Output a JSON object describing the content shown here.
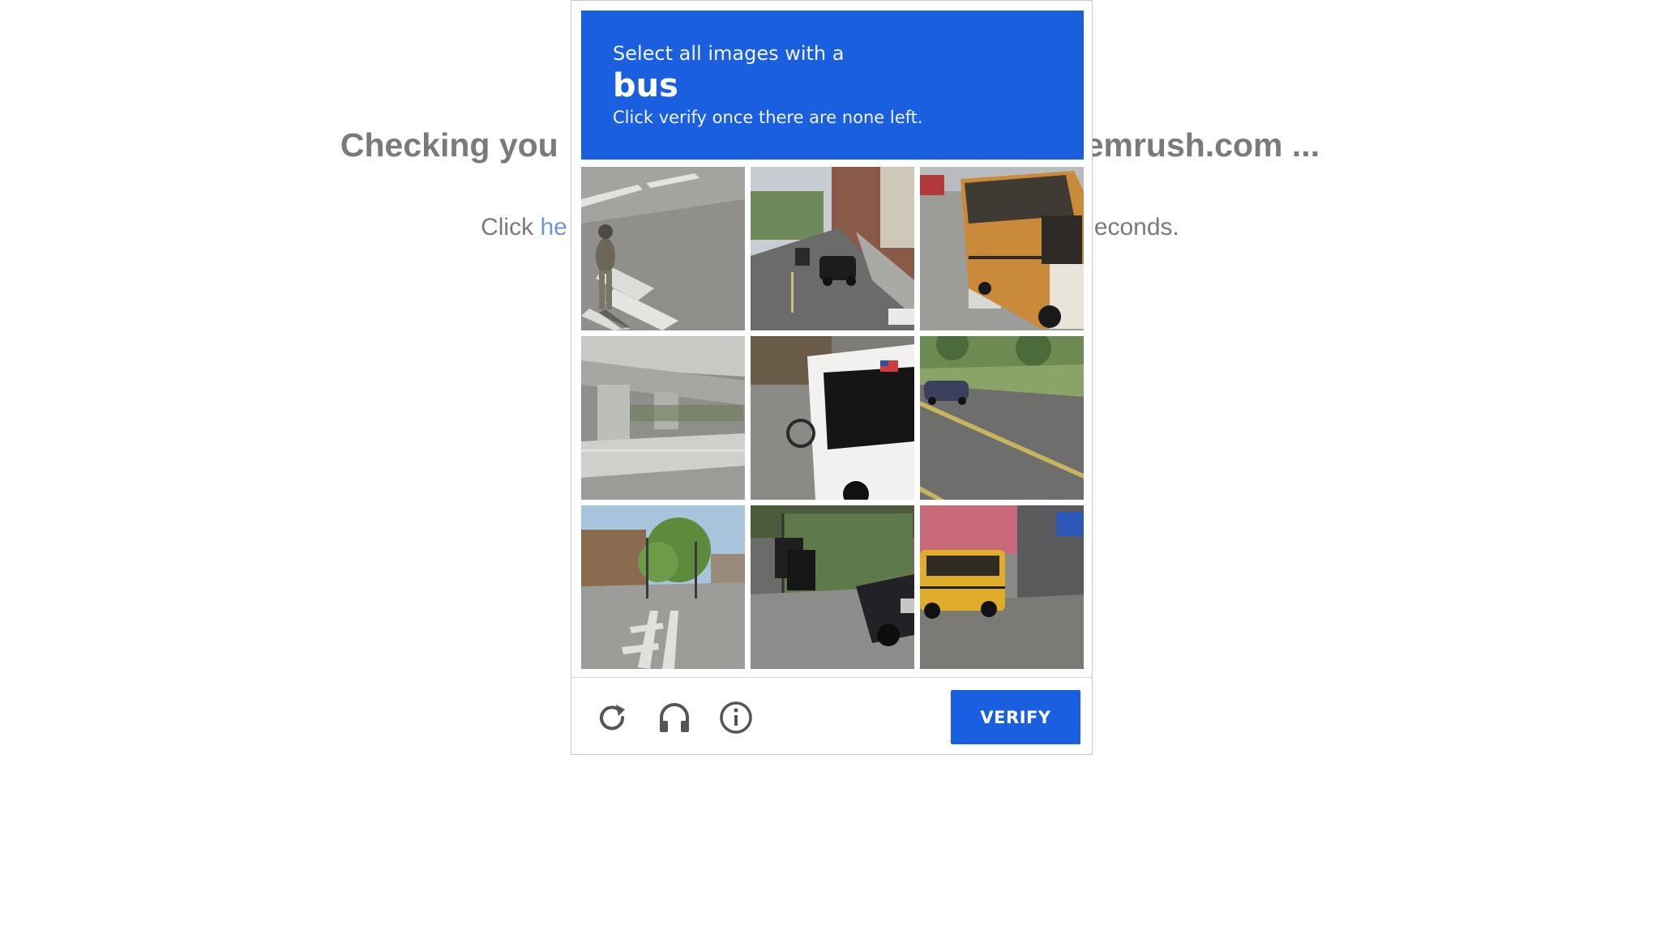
{
  "background": {
    "title_left": "Checking you",
    "title_right": "emrush.com ...",
    "sub_prefix": "Click ",
    "sub_link": "he",
    "sub_suffix": "econds."
  },
  "captcha": {
    "instruction": "Select all images with a",
    "target": "bus",
    "hint": "Click verify once there are none left.",
    "tiles": [
      {
        "id": 1,
        "scene": "person-crosswalk"
      },
      {
        "id": 2,
        "scene": "street-cars"
      },
      {
        "id": 3,
        "scene": "school-bus"
      },
      {
        "id": 4,
        "scene": "overpass"
      },
      {
        "id": 5,
        "scene": "city-bus"
      },
      {
        "id": 6,
        "scene": "road-car"
      },
      {
        "id": 7,
        "scene": "crosswalk-tree"
      },
      {
        "id": 8,
        "scene": "trash-bins-car"
      },
      {
        "id": 9,
        "scene": "school-bus-street"
      }
    ],
    "verify_label": "VERIFY",
    "icons": [
      "reload-icon",
      "headphones-icon",
      "info-icon"
    ],
    "colors": {
      "accent": "#1a5fe0"
    }
  }
}
